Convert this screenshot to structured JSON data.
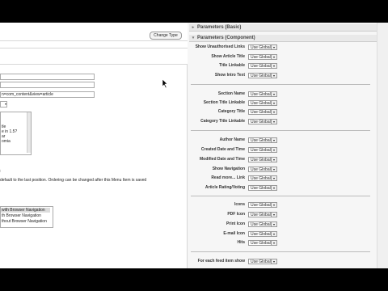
{
  "left_panel": {
    "change_type_button": "Change Type",
    "link_value": "n=com_content&view=article",
    "list_box_items": [
      "tle",
      "e in 1.5?",
      "ar",
      "omia"
    ],
    "ordering_note": "default to the last position. Ordering can be changed after this Menu Item is saved",
    "target_window_options": [
      "with Browser Navigation",
      "th Browser Navigation",
      "thout Browser Navigation"
    ]
  },
  "right_panel": {
    "basic_header": "Parameters (Basic)",
    "component_header": "Parameters (Component)",
    "global_value": "Use Global",
    "groups": [
      [
        "Show Unauthorised Links",
        "Show Article Title",
        "Title Linkable",
        "Show Intro Text"
      ],
      [
        "Section Name",
        "Section Title Linkable",
        "Category Title",
        "Category Title Linkable"
      ],
      [
        "Author Name",
        "Created Date and Time",
        "Modified Date and Time",
        "Show Navigation",
        "Read more... Link",
        "Article Rating/Voting"
      ],
      [
        "Icons",
        "PDF Icon",
        "Print Icon",
        "E-mail Icon",
        "Hits"
      ],
      [
        "For each feed item show"
      ]
    ]
  },
  "icons": {
    "collapsed_arrow": "triangle-right",
    "expanded_arrow": "triangle-down",
    "pointer": "mouse-cursor"
  }
}
